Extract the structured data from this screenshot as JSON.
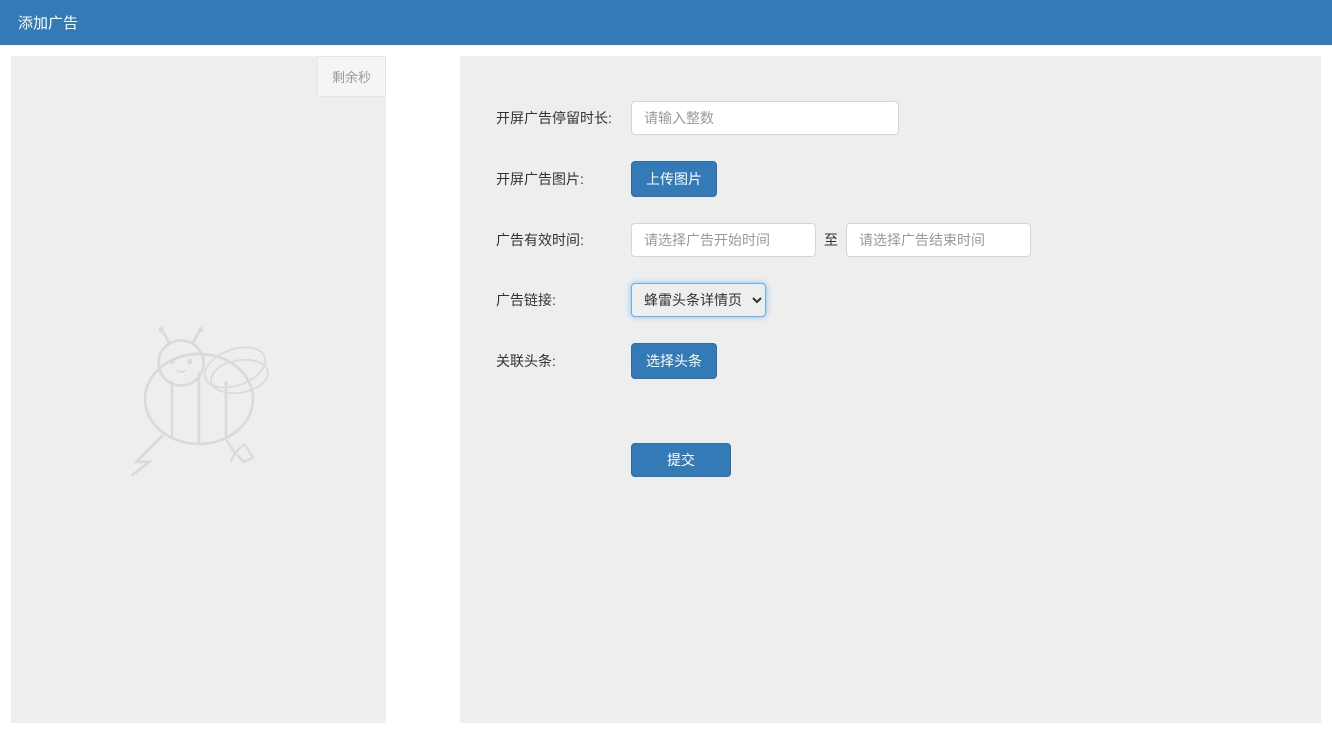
{
  "header": {
    "title": "添加广告"
  },
  "preview": {
    "timer_label": "剩余秒"
  },
  "form": {
    "duration": {
      "label": "开屏广告停留时长:",
      "placeholder": "请输入整数"
    },
    "image": {
      "label": "开屏广告图片:",
      "button": "上传图片"
    },
    "valid_time": {
      "label": "广告有效时间:",
      "start_placeholder": "请选择广告开始时间",
      "end_placeholder": "请选择广告结束时间",
      "separator": "至"
    },
    "link": {
      "label": "广告链接:",
      "selected": "蜂雷头条详情页"
    },
    "relation": {
      "label": "关联头条:",
      "button": "选择头条"
    },
    "submit": "提交"
  }
}
